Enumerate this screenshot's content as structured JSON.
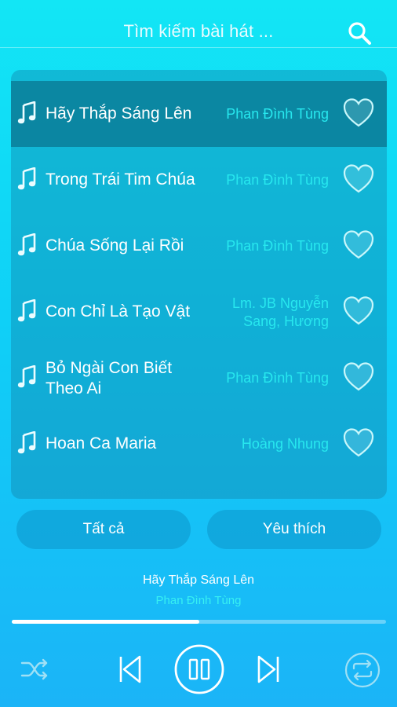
{
  "header": {
    "search_placeholder": "Tìm kiếm bài hát ..."
  },
  "songs": [
    {
      "title": "Hãy Thắp Sáng Lên",
      "artist": "Phan Đình Tùng",
      "active": true
    },
    {
      "title": "Trong Trái Tim Chúa",
      "artist": "Phan Đình Tùng",
      "active": false
    },
    {
      "title": "Chúa Sống Lại Rồi",
      "artist": "Phan Đình Tùng",
      "active": false
    },
    {
      "title": "Con Chỉ Là Tạo Vật",
      "artist": "Lm. JB Nguyễn Sang, Hương",
      "active": false
    },
    {
      "title": "Bỏ Ngài Con Biết Theo Ai",
      "artist": "Phan Đình Tùng",
      "active": false
    },
    {
      "title": "Hoan Ca Maria",
      "artist": "Hoàng Nhung",
      "active": false
    }
  ],
  "tabs": {
    "all_label": "Tất cả",
    "favorite_label": "Yêu thích"
  },
  "now_playing": {
    "title": "Hãy Thắp Sáng Lên",
    "artist": "Phan Đình Tùng",
    "progress": 0.5
  },
  "controls": {
    "shuffle_icon": "shuffle-icon",
    "previous_icon": "skip-previous-icon",
    "play_pause_icon": "pause-icon",
    "next_icon": "skip-next-icon",
    "repeat_icon": "repeat-icon"
  },
  "colors": {
    "accent_artist": "#27e8ef",
    "background_top": "#12e6f5",
    "background_bottom": "#1bb4f7"
  }
}
